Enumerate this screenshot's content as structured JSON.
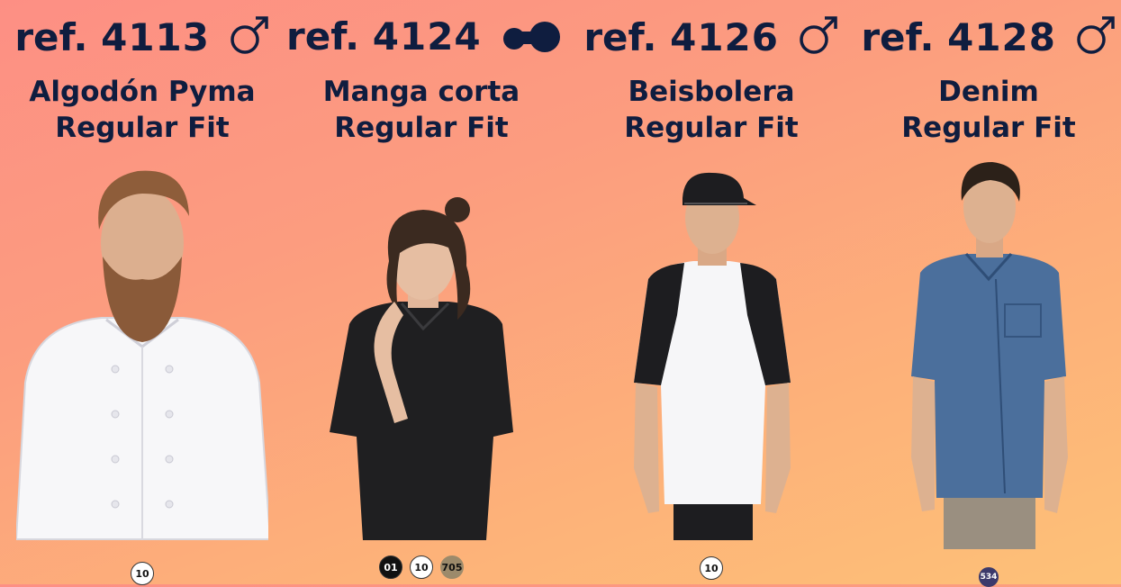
{
  "products": [
    {
      "ref_prefix": "ref.",
      "ref_number": "4113",
      "gender": "male-icon",
      "name_line1": "Algodón Pyma",
      "name_line2": "Regular Fit",
      "swatches": [
        {
          "code": "10",
          "bg": "#ffffff",
          "fg": "#111111"
        }
      ]
    },
    {
      "ref_prefix": "ref.",
      "ref_number": "4124",
      "gender": "unisex-icon",
      "name_line1": "Manga corta",
      "name_line2": "Regular Fit",
      "swatches": [
        {
          "code": "01",
          "bg": "#111111",
          "fg": "#ffffff"
        },
        {
          "code": "10",
          "bg": "#ffffff",
          "fg": "#111111"
        },
        {
          "code": "705",
          "bg": "#9c8a6b",
          "fg": "#111111"
        }
      ]
    },
    {
      "ref_prefix": "ref.",
      "ref_number": "4126",
      "gender": "male-icon",
      "name_line1": "Beisbolera",
      "name_line2": "Regular Fit",
      "swatches": [
        {
          "code": "10",
          "bg": "#ffffff",
          "fg": "#111111"
        }
      ]
    },
    {
      "ref_prefix": "ref.",
      "ref_number": "4128",
      "gender": "male-icon",
      "name_line1": "Denim",
      "name_line2": "Regular Fit",
      "swatches": [
        {
          "code": "534",
          "bg": "#3c3a6b",
          "fg": "#ffffff"
        }
      ]
    }
  ],
  "colors": {
    "text": "#0f1d3f",
    "background_top": "#fd8f84",
    "background_bottom": "#fdc178"
  }
}
